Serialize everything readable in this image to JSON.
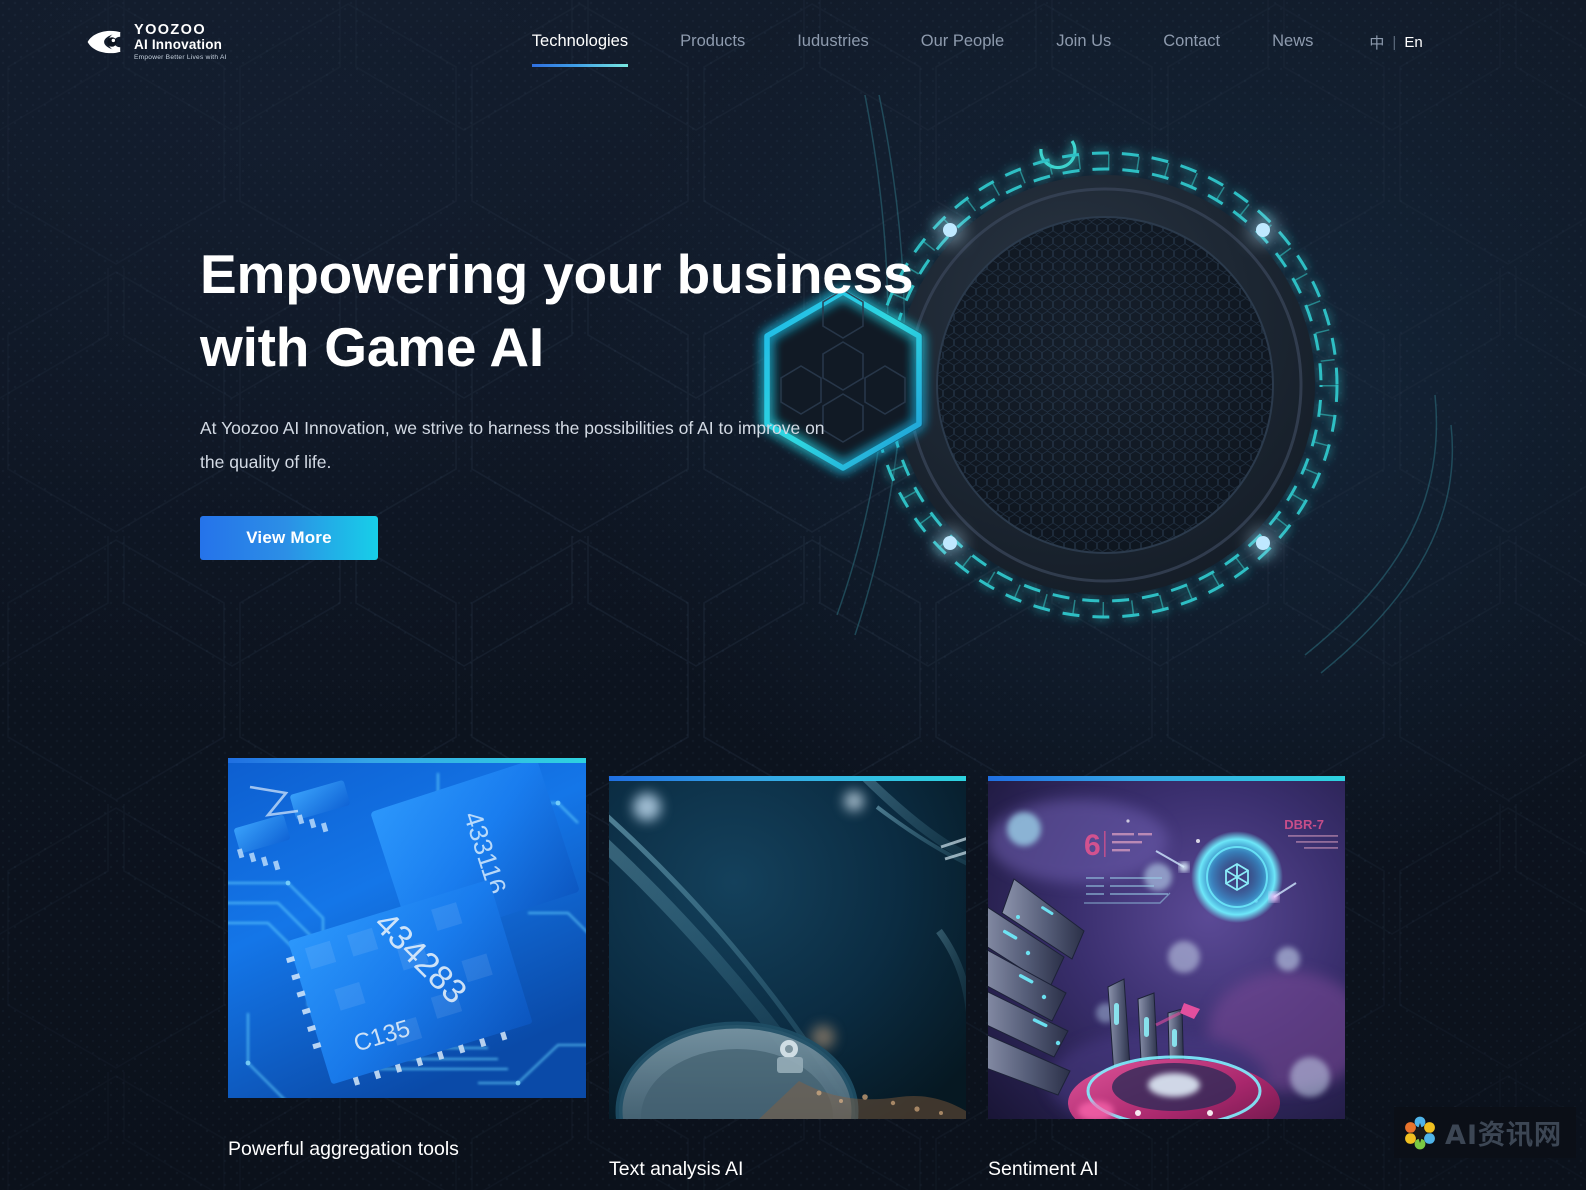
{
  "brand": {
    "logo_icon": "eye-logo-icon",
    "line1": "YOOZOO",
    "line2": "AI Innovation",
    "tagline": "Empower Better Lives with AI"
  },
  "nav": {
    "items": [
      {
        "label": "Technologies",
        "active": true
      },
      {
        "label": "Products",
        "active": false
      },
      {
        "label": "Iudustries",
        "active": false
      },
      {
        "label": "Our People",
        "active": false
      },
      {
        "label": "Join Us",
        "active": false
      },
      {
        "label": "Contact",
        "active": false
      },
      {
        "label": "News",
        "active": false
      }
    ],
    "language": {
      "zh": "中",
      "separator": "|",
      "en": "En",
      "active": "En"
    }
  },
  "hero": {
    "title_line1": "Empowering your business",
    "title_line2": "with Game AI",
    "subtitle": "At Yoozoo AI Innovation, we strive to harness the possibilities of AI to improve on the quality of life.",
    "cta_label": "View More",
    "art": {
      "gear_icon": "glowing-gear-icon",
      "hexagon_icon": "glowing-hexagon-icon",
      "accent_cyan": "#3fd8d0",
      "accent_blue": "#2f8fe8"
    }
  },
  "cards": [
    {
      "title": "Powerful aggregation tools",
      "image_alt": "blue-circuit-board-microchip",
      "chip_label_1": "434283",
      "chip_label_2": "C135",
      "chip_label_3": "433116"
    },
    {
      "title": "Text analysis AI",
      "image_alt": "dark-teal-sci-fi-structure"
    },
    {
      "title": "Sentiment AI",
      "image_alt": "purple-sci-fi-spaceship-portal",
      "hud_label_1": "6",
      "hud_label_2": "DBR-7"
    }
  ],
  "watermark": {
    "text": "AI资讯网",
    "icon": "flower-pinwheel-icon"
  },
  "theme": {
    "background": "#0d1420",
    "accent_blue": "#2573ea",
    "accent_cyan": "#17cfe8",
    "text_primary": "#ffffff",
    "text_muted": "#8e9bae"
  }
}
